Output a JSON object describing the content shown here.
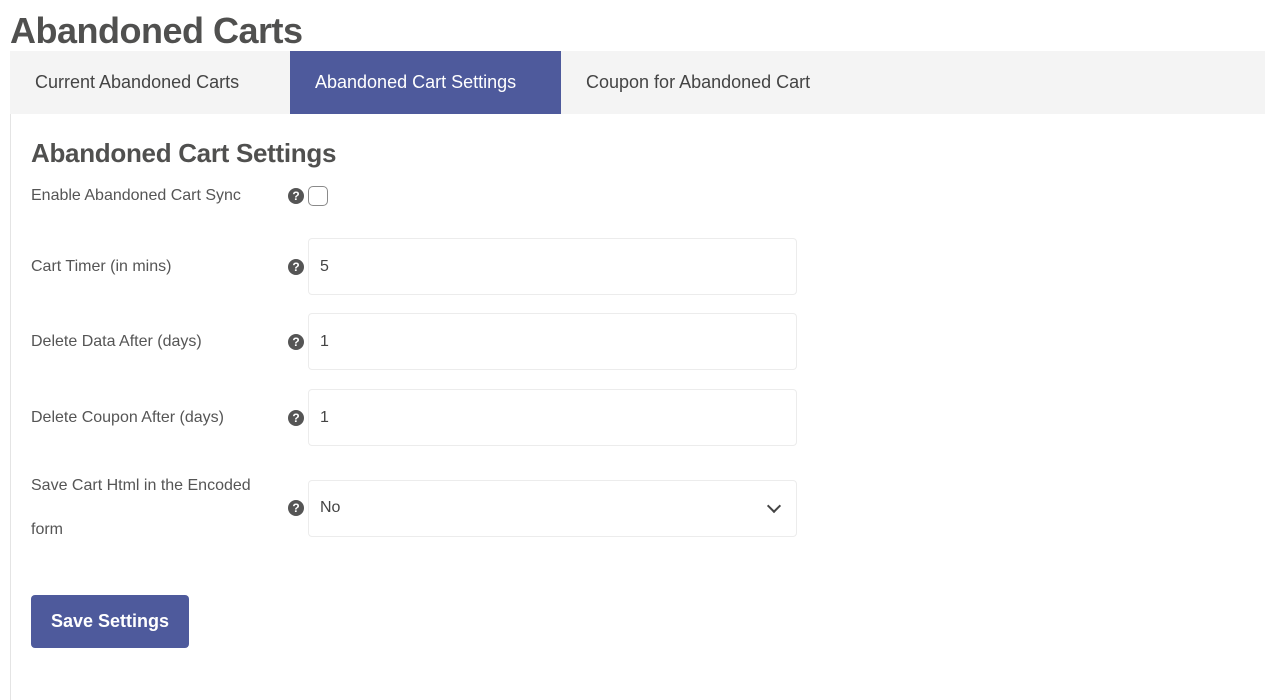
{
  "page": {
    "title": "Abandoned Carts"
  },
  "tabs": [
    {
      "label": "Current Abandoned Carts",
      "active": false
    },
    {
      "label": "Abandoned Cart Settings",
      "active": true
    },
    {
      "label": "Coupon for Abandoned Cart",
      "active": false
    }
  ],
  "settings": {
    "title": "Abandoned Cart Settings",
    "help_glyph": "?",
    "fields": [
      {
        "label": "Enable Abandoned Cart Sync",
        "type": "checkbox",
        "checked": false
      },
      {
        "label": "Cart Timer (in mins)",
        "type": "text",
        "value": "5"
      },
      {
        "label": "Delete Data After (days)",
        "type": "text",
        "value": "1"
      },
      {
        "label": "Delete Coupon After (days)",
        "type": "text",
        "value": "1"
      },
      {
        "label": "Save Cart Html in the Encoded form",
        "type": "select",
        "value": "No"
      }
    ],
    "save_label": "Save Settings"
  },
  "colors": {
    "accent": "#4e5a9c",
    "tab_bar": "#f4f4f4",
    "text": "#555555"
  }
}
